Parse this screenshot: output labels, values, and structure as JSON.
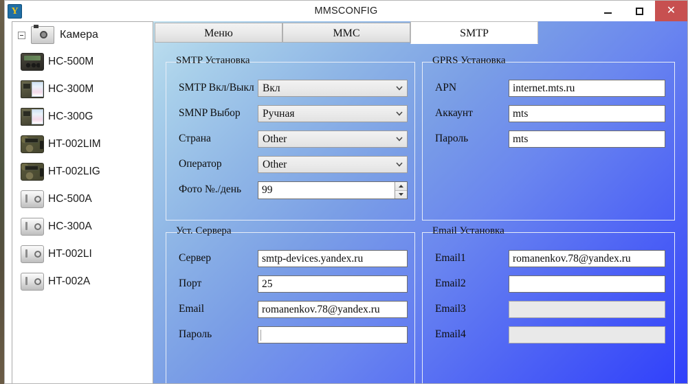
{
  "window": {
    "title": "MMSCONFIG",
    "app_icon": "camera-config-icon",
    "minimize_label": "—",
    "maximize_label": "□",
    "close_label": "✕",
    "close_color": "#c75050"
  },
  "tree": {
    "root": {
      "label": "Камера",
      "icon": "compact-camera-icon",
      "expanded": true
    },
    "items": [
      {
        "label": "HC-500M",
        "icon": "trail-camera-dark-icon"
      },
      {
        "label": "HC-300M",
        "icon": "trail-camera-lcd-icon"
      },
      {
        "label": "HC-300G",
        "icon": "trail-camera-lcd-icon"
      },
      {
        "label": "HT-002LIM",
        "icon": "trail-camera-camo-icon"
      },
      {
        "label": "HT-002LIG",
        "icon": "trail-camera-camo-icon"
      },
      {
        "label": "HC-500A",
        "icon": "generic-camera-icon"
      },
      {
        "label": "HC-300A",
        "icon": "generic-camera-icon"
      },
      {
        "label": "HT-002LI",
        "icon": "generic-camera-icon"
      },
      {
        "label": "HT-002A",
        "icon": "generic-camera-icon"
      }
    ]
  },
  "tabs": [
    {
      "id": "menu",
      "label": "Меню",
      "active": false
    },
    {
      "id": "mmc",
      "label": "MMC",
      "active": false
    },
    {
      "id": "smtp",
      "label": "SMTP",
      "active": true
    }
  ],
  "groups": {
    "smtp_setup": {
      "legend": "SMTP Установка",
      "fields": [
        {
          "label": "SMTP Вкл/Выкл",
          "type": "combo",
          "value": "Вкл"
        },
        {
          "label": "SMNP Выбор",
          "type": "combo",
          "value": "Ручная"
        },
        {
          "label": "Страна",
          "type": "combo",
          "value": "Other"
        },
        {
          "label": "Оператор",
          "type": "combo",
          "value": "Other"
        },
        {
          "label": "Фото №./день",
          "type": "spin",
          "value": "99"
        }
      ]
    },
    "gprs_setup": {
      "legend": "GPRS Установка",
      "fields": [
        {
          "label": "APN",
          "type": "text",
          "value": "internet.mts.ru",
          "disabled": false
        },
        {
          "label": "Аккаунт",
          "type": "text",
          "value": "mts",
          "disabled": false
        },
        {
          "label": "Пароль",
          "type": "text",
          "value": "mts",
          "disabled": false
        }
      ]
    },
    "server_setup": {
      "legend": "Уст. Сервера",
      "fields": [
        {
          "label": "Сервер",
          "type": "text",
          "value": "smtp-devices.yandex.ru",
          "disabled": false
        },
        {
          "label": "Порт",
          "type": "text",
          "value": "25",
          "disabled": false
        },
        {
          "label": "Email",
          "type": "text",
          "value": "romanenkov.78@yandex.ru",
          "disabled": false
        },
        {
          "label": "Пароль",
          "type": "text",
          "value": "",
          "disabled": false,
          "caret": true
        }
      ]
    },
    "email_setup": {
      "legend": "Email Установка",
      "fields": [
        {
          "label": "Email1",
          "type": "text",
          "value": "romanenkov.78@yandex.ru",
          "disabled": false
        },
        {
          "label": "Email2",
          "type": "text",
          "value": "",
          "disabled": false
        },
        {
          "label": "Email3",
          "type": "text",
          "value": "",
          "disabled": true
        },
        {
          "label": "Email4",
          "type": "text",
          "value": "",
          "disabled": true
        }
      ]
    }
  },
  "colors": {
    "panel_gradient_start": "#bfe0ef",
    "panel_gradient_end": "#2f3ffb",
    "close_button": "#c75050",
    "active_tab_bg": "#ffffff"
  }
}
